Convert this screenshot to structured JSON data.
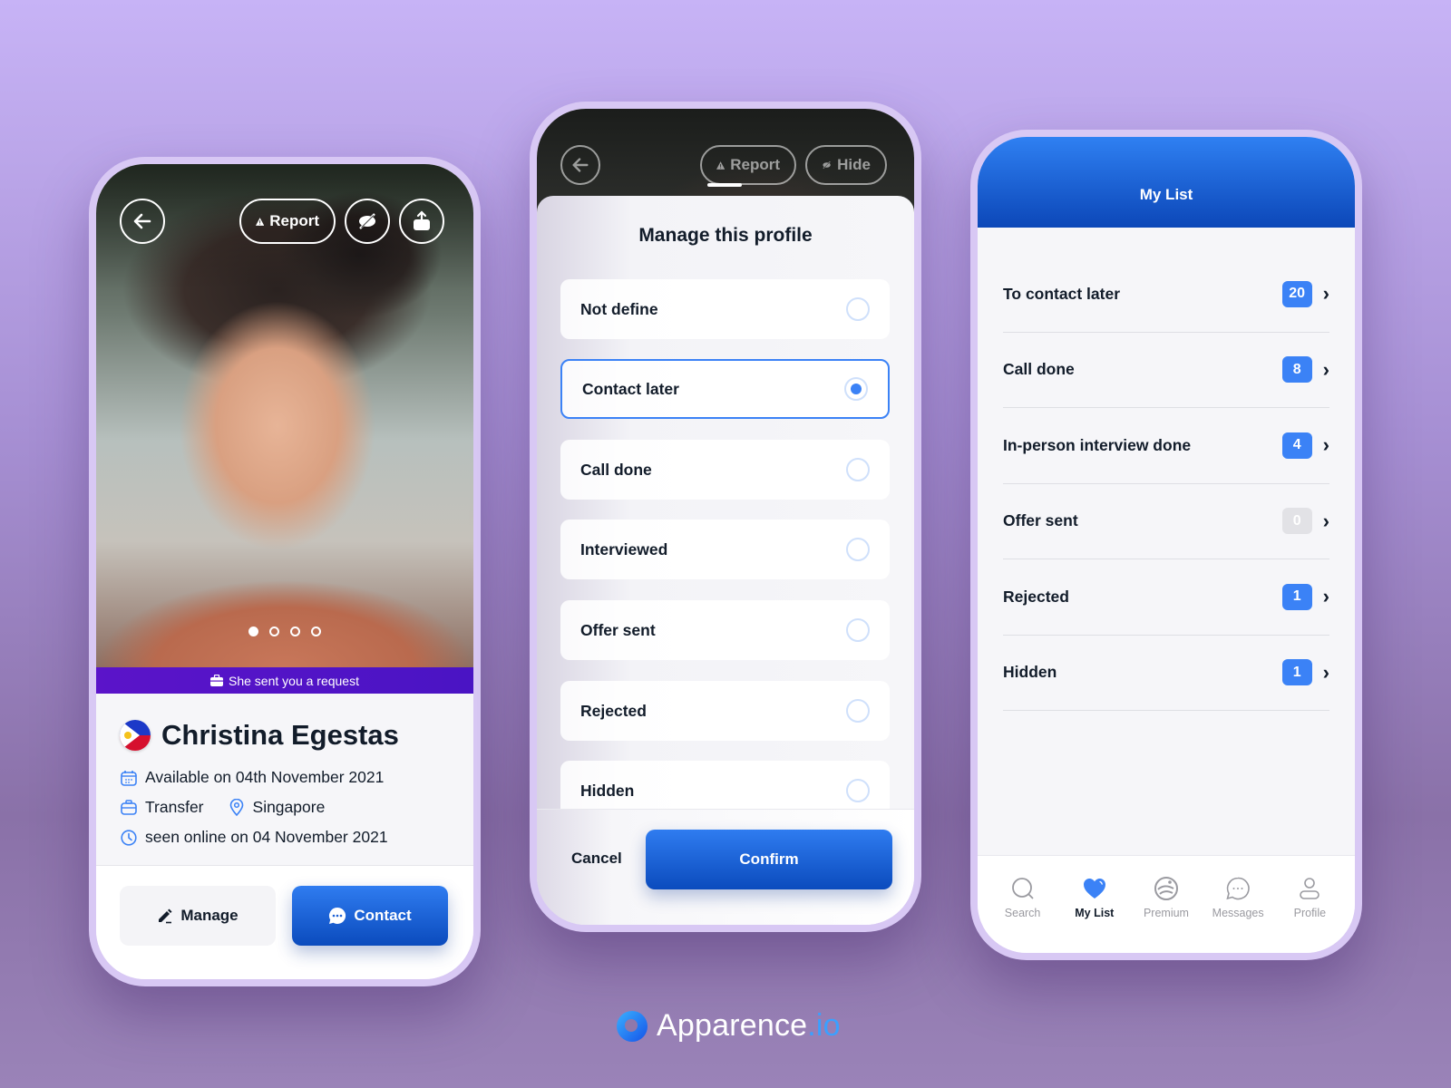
{
  "profile_screen": {
    "back_label": "←",
    "report_label": "Report",
    "carousel": {
      "total": 4,
      "active_index": 0
    },
    "request_banner": "She sent you a request",
    "name": "Christina Egestas",
    "country_flag": "philippines-flag",
    "availability": "Available on 04th November 2021",
    "contract_type": "Transfer",
    "location": "Singapore",
    "last_seen": "seen online on 04 November 2021",
    "manage_label": "Manage",
    "contact_label": "Contact"
  },
  "manage_sheet": {
    "report_label": "Report",
    "hide_label": "Hide",
    "title": "Manage this profile",
    "options": [
      {
        "label": "Not define",
        "selected": false
      },
      {
        "label": "Contact later",
        "selected": true
      },
      {
        "label": "Call done",
        "selected": false
      },
      {
        "label": "Interviewed",
        "selected": false
      },
      {
        "label": "Offer sent",
        "selected": false
      },
      {
        "label": "Rejected",
        "selected": false
      },
      {
        "label": "Hidden",
        "selected": false
      }
    ],
    "cancel_label": "Cancel",
    "confirm_label": "Confirm"
  },
  "my_list_screen": {
    "title": "My List",
    "items": [
      {
        "label": "To contact later",
        "count": "20"
      },
      {
        "label": "Call done",
        "count": "8"
      },
      {
        "label": "In-person interview done",
        "count": "4"
      },
      {
        "label": "Offer sent",
        "count": "0"
      },
      {
        "label": "Rejected",
        "count": "1"
      },
      {
        "label": "Hidden",
        "count": "1"
      }
    ],
    "tabs": [
      {
        "label": "Search",
        "icon": "search-icon",
        "active": false
      },
      {
        "label": "My List",
        "icon": "heart-icon",
        "active": true
      },
      {
        "label": "Premium",
        "icon": "premium-icon",
        "active": false
      },
      {
        "label": "Messages",
        "icon": "chat-bubble-icon",
        "active": false
      },
      {
        "label": "Profile",
        "icon": "user-icon",
        "active": false
      }
    ]
  },
  "branding": {
    "name": "Apparence",
    "tld": ".io"
  },
  "colors": {
    "accent": "#3b82f6",
    "primary_dark": "#0b4bbd",
    "banner": "#5b14c9",
    "background": "#b9a3e6"
  }
}
